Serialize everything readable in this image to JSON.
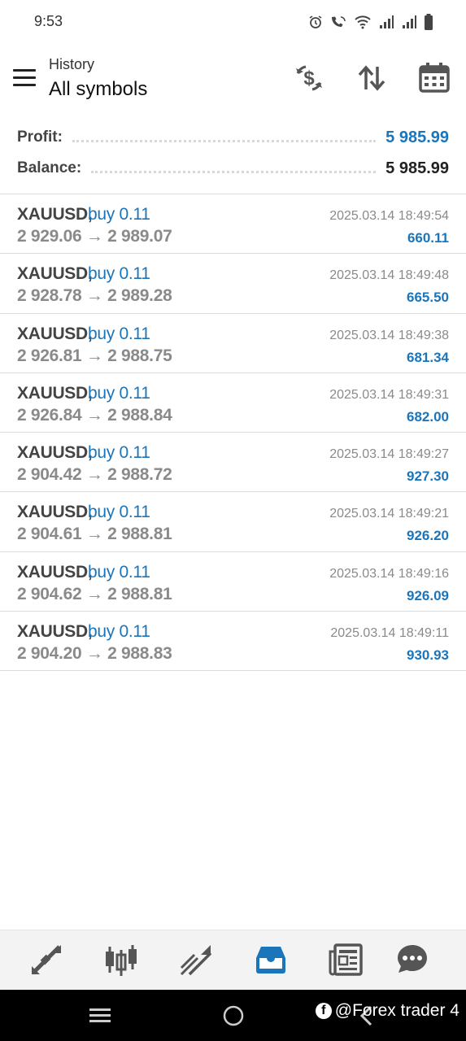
{
  "status_bar": {
    "time": "9:53"
  },
  "header": {
    "subtitle": "History",
    "title": "All symbols",
    "icons": [
      "currency-exchange-icon",
      "sort-icon",
      "calendar-icon"
    ]
  },
  "summary": {
    "profit_label": "Profit:",
    "profit_value": "5 985.99",
    "balance_label": "Balance:",
    "balance_value": "5 985.99"
  },
  "deals": [
    {
      "symbol": "XAUUSD,",
      "side": "buy 0.11",
      "prices": "2 929.06 → 2 989.07",
      "time": "2025.03.14 18:49:54",
      "profit": "660.11"
    },
    {
      "symbol": "XAUUSD,",
      "side": "buy 0.11",
      "prices": "2 928.78 → 2 989.28",
      "time": "2025.03.14 18:49:48",
      "profit": "665.50"
    },
    {
      "symbol": "XAUUSD,",
      "side": "buy 0.11",
      "prices": "2 926.81 → 2 988.75",
      "time": "2025.03.14 18:49:38",
      "profit": "681.34"
    },
    {
      "symbol": "XAUUSD,",
      "side": "buy 0.11",
      "prices": "2 926.84 → 2 988.84",
      "time": "2025.03.14 18:49:31",
      "profit": "682.00"
    },
    {
      "symbol": "XAUUSD,",
      "side": "buy 0.11",
      "prices": "2 904.42 → 2 988.72",
      "time": "2025.03.14 18:49:27",
      "profit": "927.30"
    },
    {
      "symbol": "XAUUSD,",
      "side": "buy 0.11",
      "prices": "2 904.61 → 2 988.81",
      "time": "2025.03.14 18:49:21",
      "profit": "926.20"
    },
    {
      "symbol": "XAUUSD,",
      "side": "buy 0.11",
      "prices": "2 904.62 → 2 988.81",
      "time": "2025.03.14 18:49:16",
      "profit": "926.09"
    },
    {
      "symbol": "XAUUSD,",
      "side": "buy 0.11",
      "prices": "2 904.20 → 2 988.83",
      "time": "2025.03.14 18:49:11",
      "profit": "930.93"
    }
  ],
  "tabbar": {
    "tabs": [
      "quotes-icon",
      "chart-icon",
      "trade-icon",
      "history-icon",
      "news-icon",
      "chat-icon"
    ],
    "active": "history-icon"
  },
  "watermark": {
    "text": "@Forex trader 4",
    "logo": "f"
  },
  "colors": {
    "accent": "#1b75bb",
    "gray_text": "#8a8a8a",
    "icon_gray": "#555555"
  }
}
